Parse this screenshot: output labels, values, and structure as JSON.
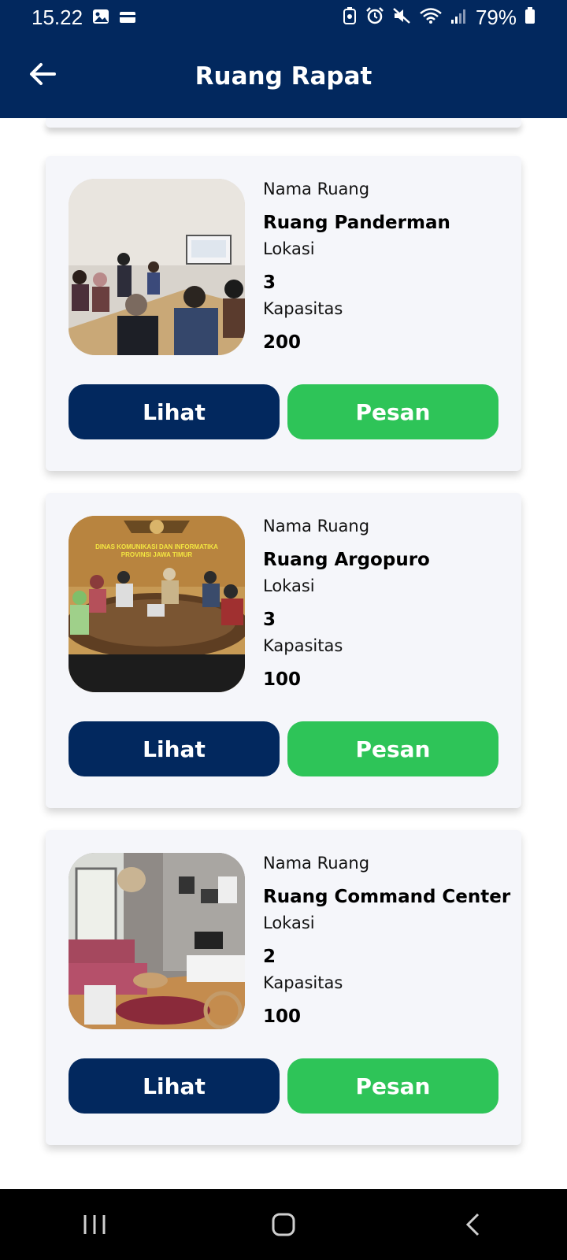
{
  "status_bar": {
    "time": "15.22",
    "battery": "79%"
  },
  "app_bar": {
    "title": "Ruang Rapat"
  },
  "labels": {
    "name": "Nama Ruang",
    "location": "Lokasi",
    "capacity": "Kapasitas"
  },
  "rooms": [
    {
      "name": "Ruang Panderman",
      "location": "3",
      "capacity": "200",
      "view_label": "Lihat",
      "book_label": "Pesan"
    },
    {
      "name": "Ruang Argopuro",
      "location": "3",
      "capacity": "100",
      "view_label": "Lihat",
      "book_label": "Pesan",
      "photo_sign_line1": "DINAS KOMUNIKASI DAN INFORMATIKA",
      "photo_sign_line2": "PROVINSI JAWA TIMUR"
    },
    {
      "name": "Ruang Command Center",
      "location": "2",
      "capacity": "100",
      "view_label": "Lihat",
      "book_label": "Pesan"
    }
  ],
  "colors": {
    "primary": "#02285e",
    "success": "#2ec458",
    "card": "#f5f6fa"
  }
}
